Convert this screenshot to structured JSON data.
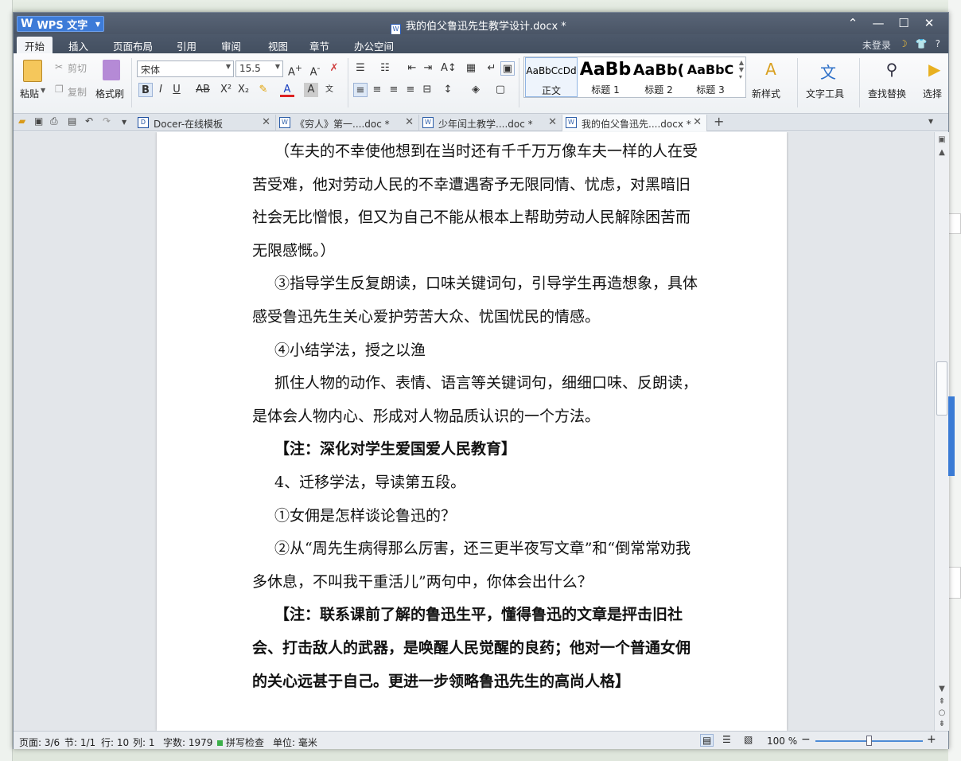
{
  "app": {
    "logo": "WPS 文字",
    "doc_title": "我的伯父鲁迅先生教学设计.docx *"
  },
  "window_controls": {
    "restore": "⌃",
    "minimize": "—",
    "maximize": "☐",
    "close": "✕"
  },
  "menu": {
    "items": [
      "开始",
      "插入",
      "页面布局",
      "引用",
      "审阅",
      "视图",
      "章节",
      "办公空间"
    ],
    "login": "未登录",
    "help": "?"
  },
  "ribbon": {
    "paste": "粘贴",
    "cut": "剪切",
    "copy": "复制",
    "format_painter": "格式刷",
    "font_name": "宋体",
    "font_size": "15.5",
    "styles": [
      {
        "sample": "AaBbCcDd",
        "label": "正文"
      },
      {
        "sample": "AaBb",
        "label": "标题 1"
      },
      {
        "sample": "AaBb(",
        "label": "标题 2"
      },
      {
        "sample": "AaBbC",
        "label": "标题 3"
      }
    ],
    "new_style": "新样式",
    "text_tools": "文字工具",
    "find_replace": "查找替换",
    "select": "选择"
  },
  "tabs": [
    {
      "label": "Docer-在线模板",
      "icon": "D"
    },
    {
      "label": "《穷人》第一....doc *",
      "icon": "W"
    },
    {
      "label": "少年闰土教学....doc *",
      "icon": "W"
    },
    {
      "label": "我的伯父鲁迅先....docx *",
      "icon": "W"
    }
  ],
  "document": {
    "paragraphs": [
      "（车夫的不幸使他想到在当时还有千千万万像车夫一样的人在受苦受难，他对劳动人民的不幸遭遇寄予无限同情、忧虑，对黑暗旧社会无比憎恨，但又为自己不能从根本上帮助劳动人民解除困苦而无限感慨。）",
      "③指导学生反复朗读，口味关键词句，引导学生再造想象，具体感受鲁迅先生关心爱护劳苦大众、忧国忧民的情感。",
      "④小结学法，授之以渔",
      "抓住人物的动作、表情、语言等关键词句，细细口味、反朗读，是体会人物内心、形成对人物品质认识的一个方法。",
      "【注：深化对学生爱国爱人民教育】",
      "4、迁移学法，导读第五段。",
      "①女佣是怎样谈论鲁迅的？",
      "②从“周先生病得那么厉害，还三更半夜写文章”和“倒常常劝我多休息，不叫我干重活儿”两句中，你体会出什么？",
      "【注：联系课前了解的鲁迅生平，懂得鲁迅的文章是抨击旧社会、打击敌人的武器，是唤醒人民觉醒的良药；他对一个普通女佣的关心远甚于自己。更进一步领略鲁迅先生的高尚人格】"
    ]
  },
  "status": {
    "page": "页面: 3/6",
    "section": "节: 1/1",
    "row": "行: 10",
    "col": "列: 1",
    "words": "字数: 1979",
    "spell": "拼写检查",
    "unit": "单位: 毫米",
    "zoom": "100 %",
    "zoom_level": 1.0
  },
  "colors": {
    "accent": "#3d7bd8",
    "titlebar": "#4d596b",
    "spell_ok": "#3cb04a"
  }
}
